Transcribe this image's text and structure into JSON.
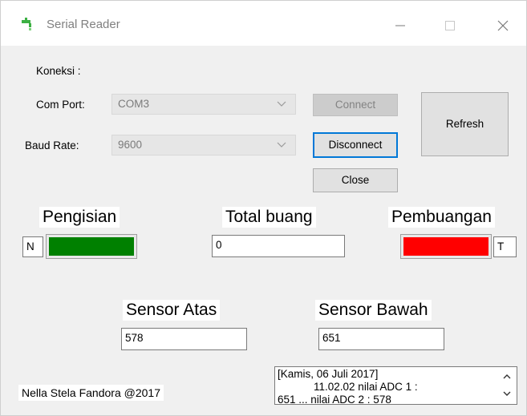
{
  "window": {
    "title": "Serial Reader"
  },
  "connection": {
    "heading": "Koneksi :",
    "com_port_label": "Com Port:",
    "com_port_value": "COM3",
    "baud_rate_label": "Baud Rate:",
    "baud_rate_value": "9600"
  },
  "buttons": {
    "connect": "Connect",
    "disconnect": "Disconnect",
    "close": "Close",
    "refresh": "Refresh"
  },
  "pengisian": {
    "label": "Pengisian",
    "state": "N",
    "indicator_color": "#008000"
  },
  "total_buang": {
    "label": "Total buang",
    "value": "0"
  },
  "pembuangan": {
    "label": "Pembuangan",
    "state": "T",
    "indicator_color": "#ff0000"
  },
  "sensor_atas": {
    "label": "Sensor Atas",
    "value": "578"
  },
  "sensor_bawah": {
    "label": "Sensor Bawah",
    "value": "651"
  },
  "log": {
    "line1": "[Kamis, 06 Juli 2017]",
    "line2": "            11.02.02 nilai ADC 1 :",
    "line3": "651 ... nilai ADC 2 : 578"
  },
  "footer": {
    "credit": "Nella Stela Fandora @2017"
  },
  "icons": [
    "app-icon",
    "minimize-icon",
    "maximize-icon",
    "close-icon",
    "chevron-down-icon",
    "scroll-up-icon",
    "scroll-down-icon"
  ]
}
